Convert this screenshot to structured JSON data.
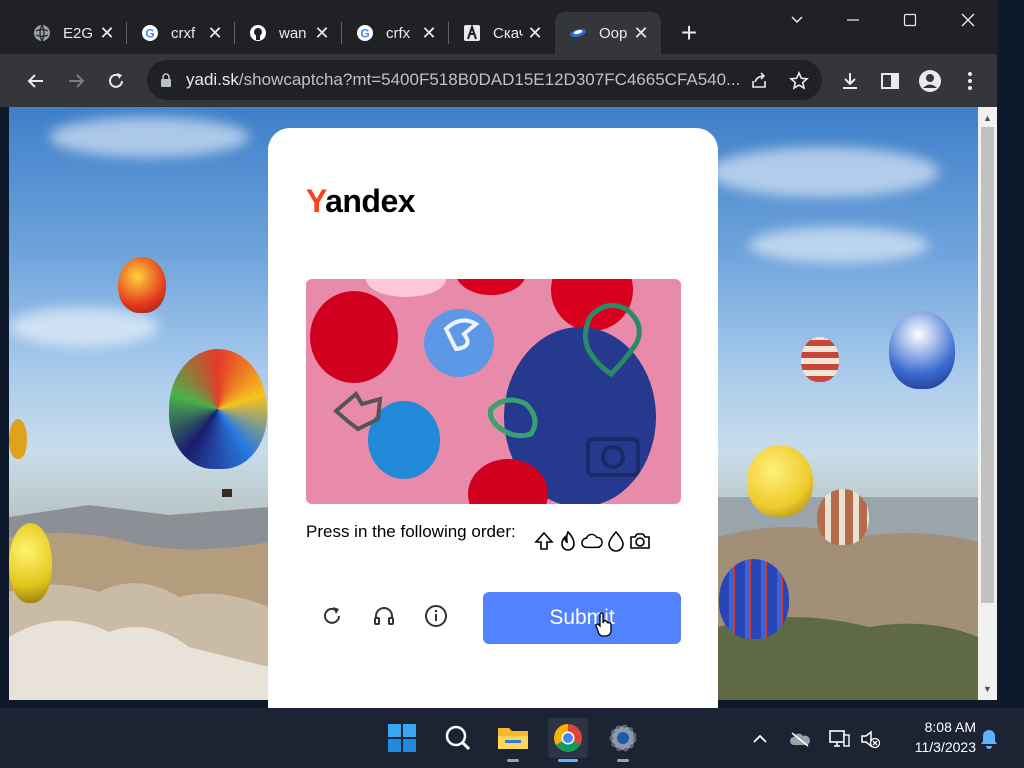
{
  "browser": {
    "tabs": [
      {
        "title": "E2G",
        "icon": "globe-icon"
      },
      {
        "title": "crxf",
        "icon": "google-icon"
      },
      {
        "title": "wan",
        "icon": "github-icon"
      },
      {
        "title": "crfx",
        "icon": "google-icon"
      },
      {
        "title": "Скач",
        "icon": "app-icon"
      },
      {
        "title": "Oop",
        "icon": "yandex-disk-icon"
      }
    ],
    "close_glyph": "✕",
    "new_tab_glyph": "+",
    "url_host": "yadi.sk",
    "url_path": "/showcaptcha?mt=5400F518B0DAD15E12D307FC4665CFA540..."
  },
  "page": {
    "logo_first": "Y",
    "logo_rest": "andex",
    "instruction": "Press in the following order:",
    "sequence_icons": [
      "arrow-up-icon",
      "flame-icon",
      "cloud-icon",
      "drop-icon",
      "camera-icon"
    ],
    "submit_label": "Submit",
    "accent_color": "#5282ff",
    "logo_color": "#fc3f1d"
  },
  "taskbar": {
    "apps": [
      "start-icon",
      "search-icon",
      "file-explorer-icon",
      "chrome-icon",
      "settings-icon"
    ],
    "time": "8:08 AM",
    "date": "11/3/2023"
  }
}
